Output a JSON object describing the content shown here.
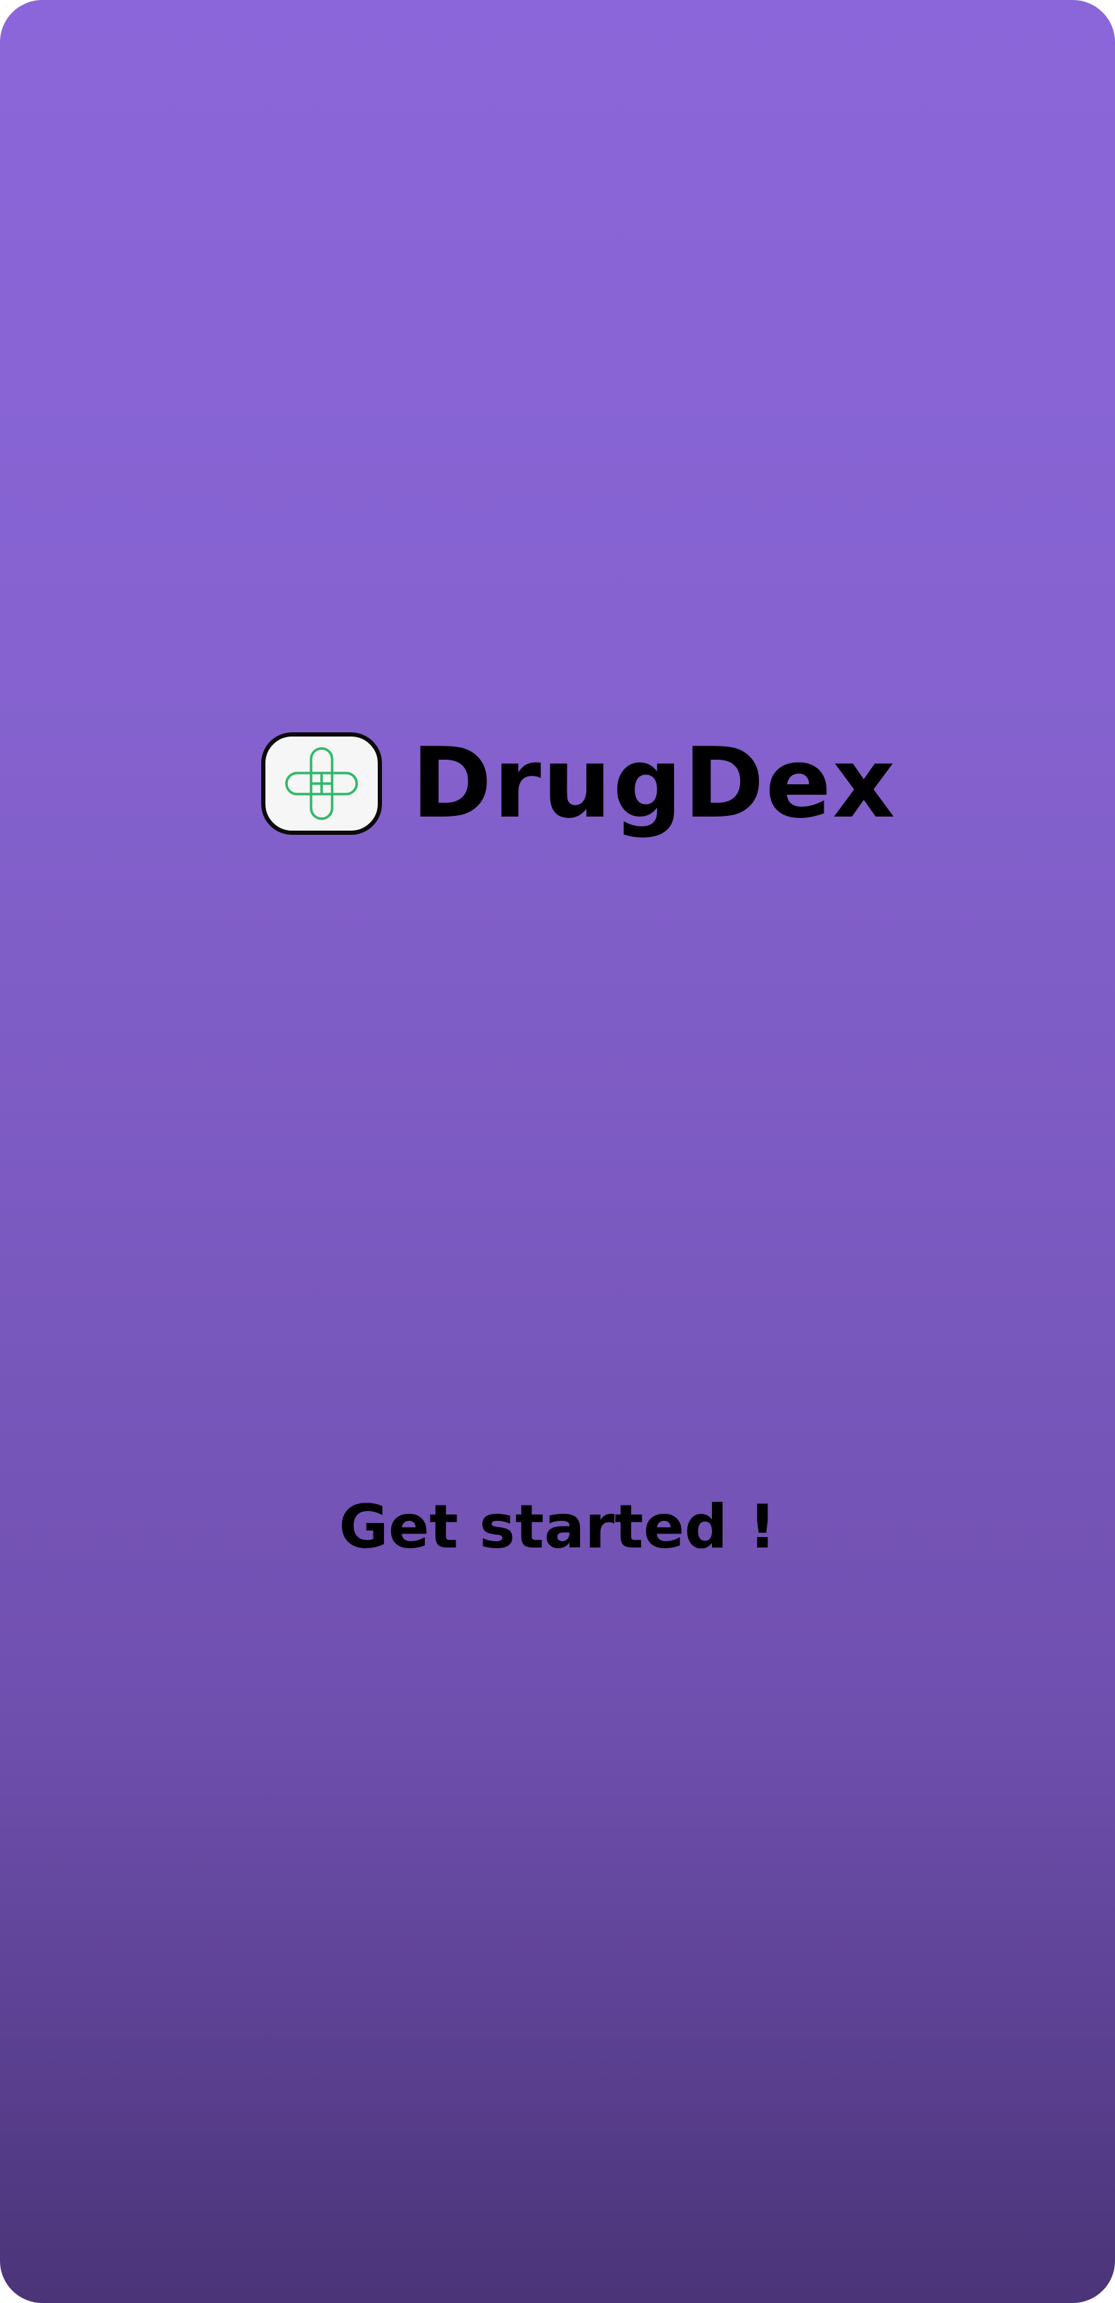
{
  "app": {
    "name": "DrugDex",
    "logo_icon": "medical-cross-pills-icon"
  },
  "onboarding": {
    "cta_label": "Get started !"
  },
  "colors": {
    "gradient_top": "#8b66da",
    "gradient_bottom": "#4b3478",
    "logo_background": "#f6f6f6",
    "logo_border": "#0b0b0b",
    "logo_accent": "#2fb86a",
    "text": "#000000"
  }
}
